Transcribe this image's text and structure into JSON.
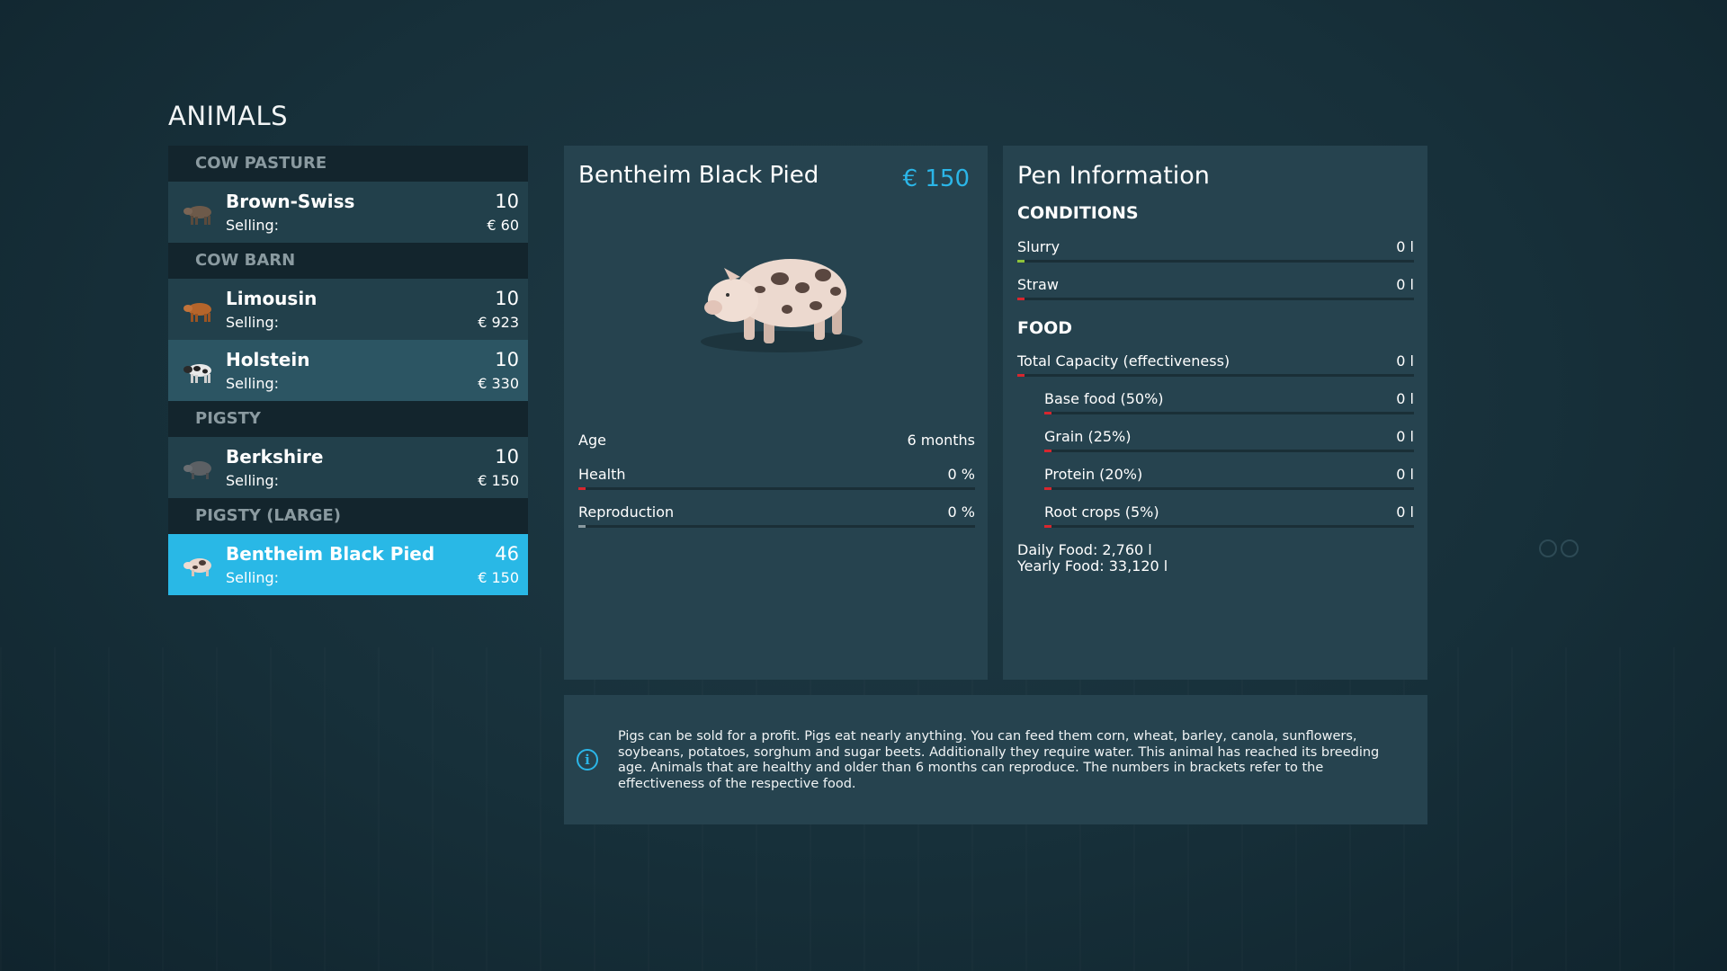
{
  "page_title": "ANIMALS",
  "sections": [
    {
      "header": "COW PASTURE",
      "animals": [
        {
          "name": "Brown-Swiss",
          "count": "10",
          "selling_label": "Selling:",
          "selling_value": "€ 60",
          "icon": "cow-brown-icon"
        }
      ]
    },
    {
      "header": "COW BARN",
      "animals": [
        {
          "name": "Limousin",
          "count": "10",
          "selling_label": "Selling:",
          "selling_value": "€ 923",
          "icon": "cow-limousin-icon"
        },
        {
          "name": "Holstein",
          "count": "10",
          "selling_label": "Selling:",
          "selling_value": "€ 330",
          "icon": "cow-holstein-icon"
        }
      ]
    },
    {
      "header": "PIGSTY",
      "animals": [
        {
          "name": "Berkshire",
          "count": "10",
          "selling_label": "Selling:",
          "selling_value": "€ 150",
          "icon": "pig-berkshire-icon"
        }
      ]
    },
    {
      "header": "PIGSTY (LARGE)",
      "animals": [
        {
          "name": "Bentheim Black Pied",
          "count": "46",
          "selling_label": "Selling:",
          "selling_value": "€ 150",
          "icon": "pig-bentheim-icon"
        }
      ]
    }
  ],
  "detail": {
    "title": "Bentheim Black Pied",
    "price": "€ 150",
    "image_icon": "pig-bentheim-image",
    "age_label": "Age",
    "age_value": "6 months",
    "health_label": "Health",
    "health_value": "0 %",
    "health_fraction": 0,
    "reproduction_label": "Reproduction",
    "reproduction_value": "0 %",
    "reproduction_fraction": 0
  },
  "pen": {
    "title": "Pen Information",
    "conditions_header": "CONDITIONS",
    "slurry_label": "Slurry",
    "slurry_value": "0 l",
    "straw_label": "Straw",
    "straw_value": "0 l",
    "food_header": "FOOD",
    "total_label": "Total Capacity (effectiveness)",
    "total_value": "0 l",
    "base_label": "Base food (50%)",
    "base_value": "0 l",
    "grain_label": "Grain (25%)",
    "grain_value": "0 l",
    "protein_label": "Protein (20%)",
    "protein_value": "0 l",
    "root_label": "Root crops (5%)",
    "root_value": "0 l",
    "daily_food": "Daily Food: 2,760 l",
    "yearly_food": "Yearly Food: 33,120 l"
  },
  "info": {
    "icon": "info-icon",
    "text": "Pigs can be sold for a profit. Pigs eat nearly anything. You can feed them corn, wheat, barley, canola, sunflowers, soybeans, potatoes, sorghum and sugar beets. Additionally they require water. This animal has reached its breeding age. Animals that are healthy and older than 6 months can reproduce. The numbers in brackets refer to the effectiveness of the respective food."
  },
  "colors": {
    "accent": "#29b8e6",
    "price": "#2bb6e8",
    "bar_empty_marker": "#d7262e",
    "bar_slurry_marker": "#8fc33a"
  }
}
